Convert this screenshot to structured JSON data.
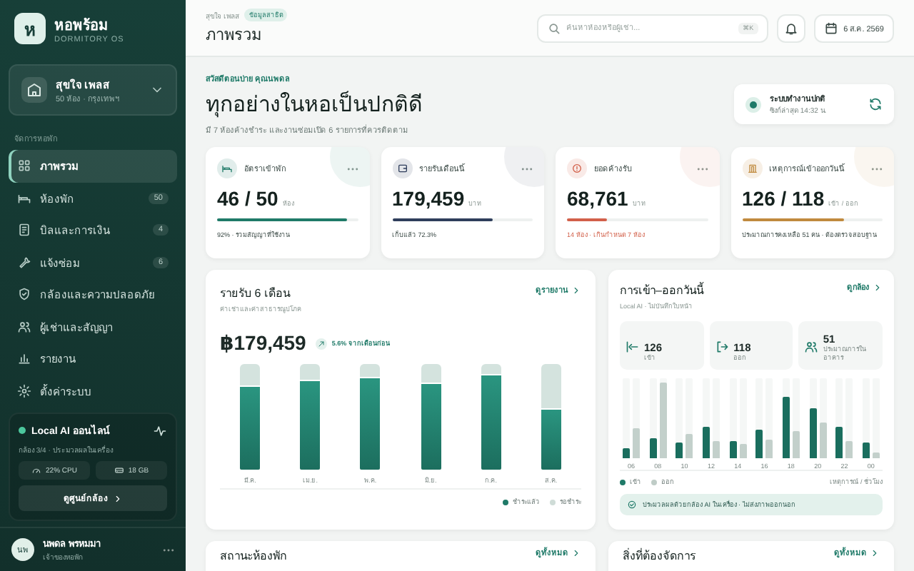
{
  "sidebar": {
    "logo_mark": "ห",
    "brand": "หอพร้อม",
    "tagline": "DORMITORY OS",
    "property": {
      "name": "สุขใจ เพลส",
      "meta": "50 ห้อง · กรุงเทพฯ"
    },
    "section_label": "จัดการหอพัก",
    "items": [
      {
        "label": "ภาพรวม",
        "selected": true
      },
      {
        "label": "ห้องพัก",
        "count": "50",
        "selected": false
      },
      {
        "label": "บิลและการเงิน",
        "count": "4",
        "selected": false
      },
      {
        "label": "แจ้งซ่อม",
        "count": "6",
        "selected": false
      },
      {
        "label": "กล้องและความปลอดภัย",
        "selected": false
      },
      {
        "label": "ผู้เช่าและสัญญา",
        "selected": false
      },
      {
        "label": "รายงาน",
        "selected": false
      },
      {
        "label": "ตั้งค่าระบบ",
        "selected": false
      }
    ],
    "ai_card": {
      "title": "Local AI ออนไลน์",
      "subtitle": "กล้อง 3/4 · ประมวลผลในเครื่อง",
      "cpu": "22% CPU",
      "storage": "18 GB",
      "button": "ดูศูนย์กล้อง"
    },
    "user": {
      "initials": "นพ",
      "name": "นพดล พรหมมา",
      "role": "เจ้าของหอพัก"
    }
  },
  "header": {
    "breadcrumb": "สุขใจ เพลส",
    "badge": "ข้อมูลสาธิต",
    "title": "ภาพรวม",
    "search": {
      "placeholder": "ค้นหาห้องหรือผู้เช่า...",
      "shortcut": "⌘K"
    },
    "date": "6 ส.ค. 2569"
  },
  "hero": {
    "greeting": "สวัสดีตอนบ่าย คุณนพดล",
    "title": "ทุกอย่างในหอเป็นปกติดี",
    "summary": "มี 7 ห้องค้างชำระ และงานซ่อมเปิด 6 รายการที่ควรติดตาม",
    "status": {
      "title": "ระบบทำงานปกติ",
      "subtitle": "ซิงก์ล่าสุด 14:32 น."
    }
  },
  "stats": [
    {
      "kind": "occupancy",
      "title": "อัตราเข้าพัก",
      "value": "46 / 50",
      "unit": "ห้อง",
      "level": 0.92,
      "note": "92% · รวมสัญญาที่ใช้งาน",
      "color": "#1f7a68",
      "alert": false
    },
    {
      "kind": "revenue",
      "title": "รายรับเดือนนี้",
      "value": "179,459",
      "unit": "บาท",
      "level": 0.72,
      "note": "เก็บแล้ว 72.3%",
      "color": "#2f3e5c",
      "alert": false
    },
    {
      "kind": "overdue",
      "title": "ยอดค้างรับ",
      "value": "68,761",
      "unit": "บาท",
      "level": 0.28,
      "note": "14 ห้อง · เกินกำหนด 7 ห้อง",
      "color": "#d2604a",
      "alert": true
    },
    {
      "kind": "traffic",
      "title": "เหตุการณ์เข้าออกวันนี้",
      "value": "126 / 118",
      "unit": "เข้า / ออก",
      "level": 0.73,
      "note": "ประมาณการคงเหลือ 51 คน · ต้องตรวจสอบฐาน",
      "color": "#c08a3e",
      "alert": false
    }
  ],
  "revenue": {
    "title": "รายรับ 6 เดือน",
    "subtitle": "ค่าเช่าและค่าสาธารณูปโภค",
    "link": "ดูรายงาน",
    "total": "฿179,459",
    "change": "5.6% จากเดือนก่อน",
    "months": [
      {
        "label": "มี.ค.",
        "level": 0.78
      },
      {
        "label": "เม.ย.",
        "level": 0.84
      },
      {
        "label": "พ.ค.",
        "level": 0.87
      },
      {
        "label": "มิ.ย.",
        "level": 0.81
      },
      {
        "label": "ก.ค.",
        "level": 0.89
      },
      {
        "label": "ส.ค.",
        "level": 0.57
      }
    ],
    "legend": [
      {
        "label": "ชำระแล้ว",
        "color": "#1f7a68"
      },
      {
        "label": "รอชำระ",
        "color": "#cfdcd7"
      }
    ]
  },
  "checkins": {
    "title": "การเข้า–ออกวันนี้",
    "subtitle": "Local AI · ไม่บันทึกใบหน้า",
    "link": "ดูกล้อง",
    "stats": [
      {
        "kind": "in",
        "value": "126",
        "label": "เข้า"
      },
      {
        "kind": "out",
        "value": "118",
        "label": "ออก"
      },
      {
        "kind": "people",
        "value": "51",
        "label": "ประมาณการในอาคาร"
      }
    ],
    "hours": [
      {
        "label": "06",
        "bars": [
          {
            "kind": "in",
            "level": 0.12
          },
          {
            "kind": "out",
            "level": 0.38
          }
        ]
      },
      {
        "label": "08",
        "bars": [
          {
            "kind": "in",
            "level": 0.25
          },
          {
            "kind": "out",
            "level": 0.95
          }
        ]
      },
      {
        "label": "10",
        "bars": [
          {
            "kind": "in",
            "level": 0.19
          },
          {
            "kind": "out",
            "level": 0.31
          }
        ]
      },
      {
        "label": "12",
        "bars": [
          {
            "kind": "in",
            "level": 0.4
          },
          {
            "kind": "out",
            "level": 0.22
          }
        ]
      },
      {
        "label": "14",
        "bars": [
          {
            "kind": "in",
            "level": 0.22
          },
          {
            "kind": "out",
            "level": 0.17
          }
        ]
      },
      {
        "label": "16",
        "bars": [
          {
            "kind": "in",
            "level": 0.36
          },
          {
            "kind": "out",
            "level": 0.24
          }
        ]
      },
      {
        "label": "18",
        "bars": [
          {
            "kind": "in",
            "level": 0.76
          },
          {
            "kind": "out",
            "level": 0.34
          }
        ]
      },
      {
        "label": "20",
        "bars": [
          {
            "kind": "in",
            "level": 0.62
          },
          {
            "kind": "out",
            "level": 0.45
          }
        ]
      },
      {
        "label": "22",
        "bars": [
          {
            "kind": "in",
            "level": 0.39
          },
          {
            "kind": "out",
            "level": 0.22
          }
        ]
      },
      {
        "label": "00",
        "bars": [
          {
            "kind": "in",
            "level": 0.19
          },
          {
            "kind": "out",
            "level": 0.07
          }
        ]
      }
    ],
    "legend": [
      {
        "label": "เข้า",
        "color": "#1f7a68"
      },
      {
        "label": "ออก",
        "color": "#bfccc7"
      }
    ],
    "unit_note": "เหตุการณ์ / ชั่วโมง",
    "notice": "ประมวลผลด้วยกล้อง AI ในเครื่อง · ไม่ส่งภาพออกนอก"
  },
  "bottom": [
    {
      "title": "สถานะห้องพัก",
      "link": "ดูทั้งหมด"
    },
    {
      "title": "สิ่งที่ต้องจัดการ",
      "link": "ดูทั้งหมด"
    }
  ]
}
